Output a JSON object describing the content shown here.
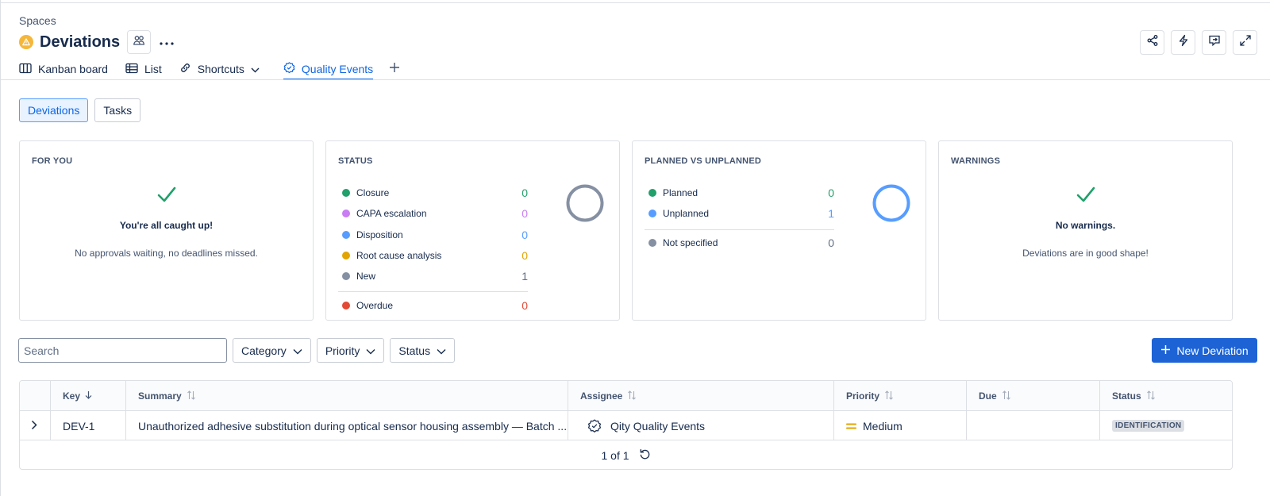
{
  "breadcrumb": "Spaces",
  "space": {
    "title": "Deviations"
  },
  "tabs": [
    {
      "label": "Kanban board"
    },
    {
      "label": "List"
    },
    {
      "label": "Shortcuts"
    },
    {
      "label": "Quality Events",
      "active": true
    }
  ],
  "segments": [
    {
      "label": "Deviations",
      "active": true
    },
    {
      "label": "Tasks"
    }
  ],
  "cards": {
    "for_you": {
      "title": "FOR YOU",
      "headline": "You're all caught up!",
      "subtext": "No approvals waiting, no deadlines missed."
    },
    "status": {
      "title": "STATUS",
      "items": [
        {
          "label": "Closure",
          "value": "0",
          "color": "#22a06b"
        },
        {
          "label": "CAPA escalation",
          "value": "0",
          "color": "#c97cf4"
        },
        {
          "label": "Disposition",
          "value": "0",
          "color": "#579dff"
        },
        {
          "label": "Root cause analysis",
          "value": "0",
          "color": "#e2a400"
        },
        {
          "label": "New",
          "value": "1",
          "color": "#8590a2"
        }
      ],
      "overdue": {
        "label": "Overdue",
        "value": "0",
        "color": "#e34935"
      }
    },
    "planned": {
      "title": "PLANNED VS UNPLANNED",
      "items": [
        {
          "label": "Planned",
          "value": "0",
          "color": "#22a06b"
        },
        {
          "label": "Unplanned",
          "value": "1",
          "color": "#579dff"
        }
      ],
      "not_specified": {
        "label": "Not specified",
        "value": "0",
        "color": "#8590a2"
      }
    },
    "warnings": {
      "title": "WARNINGS",
      "headline": "No warnings.",
      "subtext": "Deviations are in good shape!"
    }
  },
  "toolbar": {
    "search_placeholder": "Search",
    "filters": [
      "Category",
      "Priority",
      "Status"
    ],
    "new_button": "New Deviation"
  },
  "table": {
    "columns": [
      "Key",
      "Summary",
      "Assignee",
      "Priority",
      "Due",
      "Status"
    ],
    "rows": [
      {
        "key": "DEV-1",
        "summary": "Unauthorized adhesive substitution during optical sensor housing assembly — Batch ...",
        "assignee": "Qity Quality Events",
        "priority": "Medium",
        "due": "",
        "status": "IDENTIFICATION"
      }
    ],
    "pagination": "1 of 1"
  },
  "colors": {
    "accent": "#0c66e4",
    "primary_button": "#1d63d6",
    "success": "#22a06b",
    "priority_medium": "#e2a400"
  }
}
